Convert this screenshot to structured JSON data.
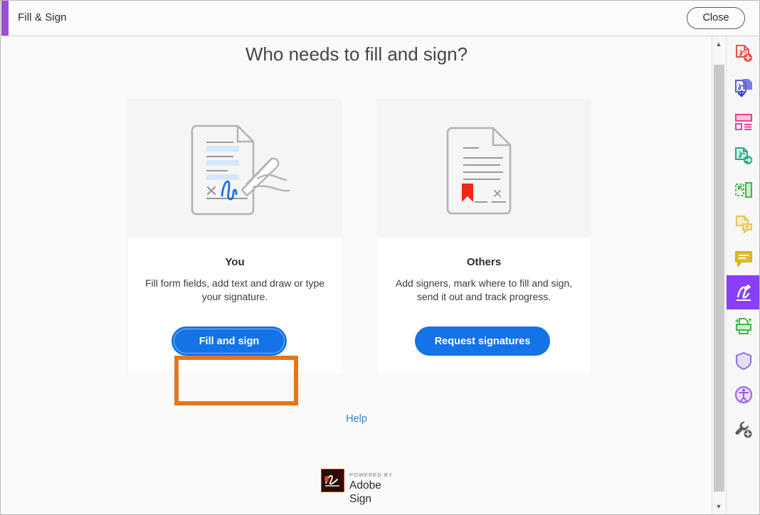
{
  "window": {
    "title": "Fill & Sign",
    "accent_color": "#9a4ed6",
    "close_label": "Close"
  },
  "main": {
    "heading": "Who needs to fill and sign?",
    "help_label": "Help",
    "cards": [
      {
        "id": "you",
        "title": "You",
        "description": "Fill form fields, add text and draw or type your signature.",
        "button_label": "Fill and sign",
        "button_color": "#1473e6",
        "illustration": "document-with-pen-signature",
        "highlighted": "true"
      },
      {
        "id": "others",
        "title": "Others",
        "description": "Add signers, mark where to fill and sign, send it out and track progress.",
        "button_label": "Request signatures",
        "button_color": "#1473e6",
        "illustration": "document-with-red-ribbon-marker",
        "highlighted": "false"
      }
    ],
    "highlight_color": "#e8751a"
  },
  "footer": {
    "powered_by": "POWERED BY",
    "brand": "Adobe Sign",
    "mark_color": "#d23c10"
  },
  "scrollbar": {
    "up_arrow": "▲",
    "down_arrow": "▼"
  },
  "toolrail": {
    "items": [
      {
        "name": "create-pdf",
        "label": "Create PDF",
        "color": "#e8504a",
        "active": "false"
      },
      {
        "name": "combine-files",
        "label": "Combine Files",
        "color": "#5b5bd6",
        "active": "false"
      },
      {
        "name": "organize-pages",
        "label": "Organize Pages",
        "color": "#e8409a",
        "active": "false"
      },
      {
        "name": "export-pdf",
        "label": "Export PDF",
        "color": "#2fa98c",
        "active": "false"
      },
      {
        "name": "edit-pdf",
        "label": "Edit PDF",
        "color": "#45b649",
        "active": "false"
      },
      {
        "name": "comment-page",
        "label": "Comment",
        "color": "#e3c75b",
        "active": "false"
      },
      {
        "name": "comment-bubble",
        "label": "Comment",
        "color": "#d4b424",
        "active": "false"
      },
      {
        "name": "fill-and-sign",
        "label": "Fill & Sign",
        "color": "#8a3ffc",
        "active": "true"
      },
      {
        "name": "enhance-scans",
        "label": "Enhance Scans",
        "color": "#45b649",
        "active": "false"
      },
      {
        "name": "protect",
        "label": "Protect",
        "color": "#8a6fe8",
        "active": "false"
      },
      {
        "name": "accessibility",
        "label": "Accessibility",
        "color": "#9b5ce6",
        "active": "false"
      },
      {
        "name": "more-tools",
        "label": "More Tools",
        "color": "#5a5a5a",
        "active": "false"
      }
    ]
  }
}
